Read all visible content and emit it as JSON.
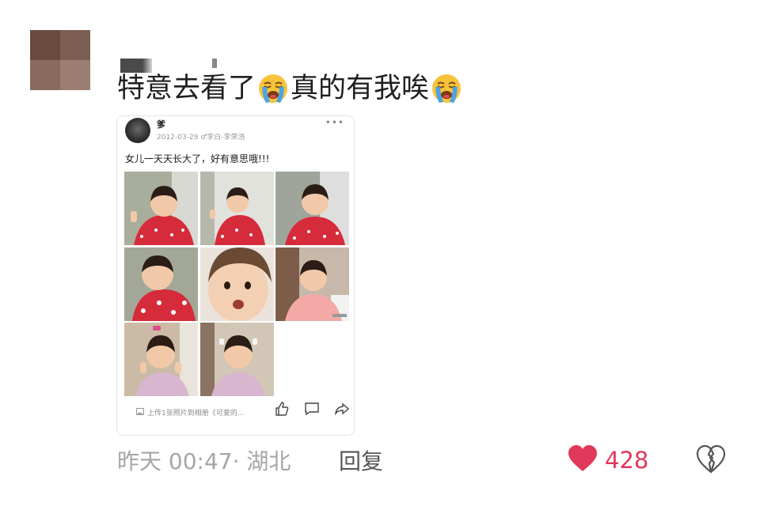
{
  "comment": {
    "text_part1": "特意去看了",
    "text_part2": "真的有我唉",
    "emoji_icon": "loudly-crying-face"
  },
  "shared_post": {
    "author": "爹",
    "date": "2012-03-29",
    "source": "♂李白-李荣浩",
    "text": "女儿一天天长大了，好有意思哦!!!",
    "footer": "上传1张照片到相册《可爱的...",
    "photo_count": 8,
    "actions": [
      "like-icon",
      "comment-icon",
      "share-icon"
    ]
  },
  "meta": {
    "time_location": "昨天 00:47· 湖北",
    "reply_label": "回复"
  },
  "likes": {
    "count": "428",
    "color": "#e0395a"
  },
  "dislike_icon": "broken-heart-outline"
}
